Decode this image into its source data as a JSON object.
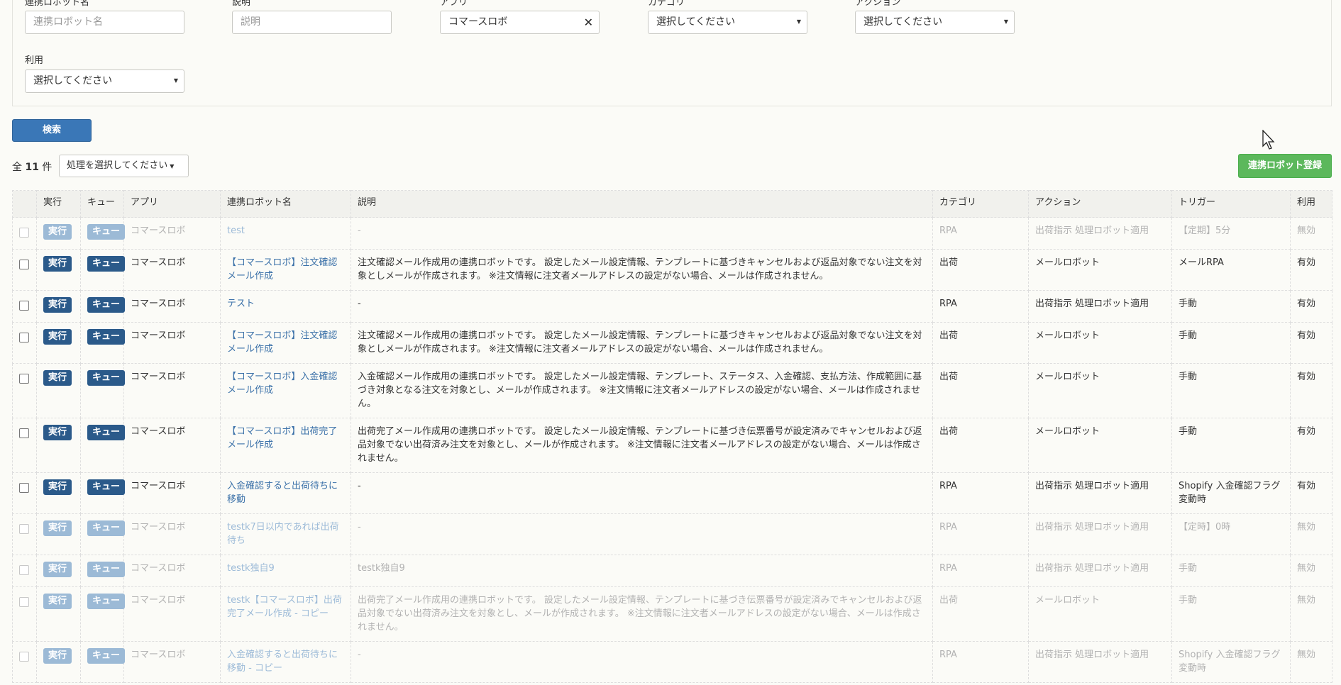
{
  "filters": {
    "robot_name": {
      "label": "連携ロボット名",
      "placeholder": "連携ロボット名"
    },
    "description": {
      "label": "説明",
      "placeholder": "説明"
    },
    "app": {
      "label": "アプリ",
      "value": "コマースロボ"
    },
    "category": {
      "label": "カテゴリ",
      "value": "選択してください"
    },
    "action": {
      "label": "アクション",
      "value": "選択してください"
    },
    "usage": {
      "label": "利用",
      "value": "選択してください"
    }
  },
  "search_button": "検索",
  "total": {
    "prefix": "全",
    "count": "11",
    "suffix": "件"
  },
  "bulk_action": "処理を選択してください",
  "register_button": "連携ロボット登録",
  "table": {
    "headers": [
      "実行",
      "キュー",
      "アプリ",
      "連携ロボット名",
      "説明",
      "カテゴリ",
      "アクション",
      "トリガー",
      "利用"
    ],
    "run_label": "実行",
    "queue_label": "キュー",
    "rows": [
      {
        "app": "コマースロボ",
        "name": "test",
        "desc": "-",
        "category": "RPA",
        "action": "出荷指示 処理ロボット適用",
        "trigger": "【定期】5分",
        "usage": "無効"
      },
      {
        "app": "コマースロボ",
        "name": "【コマースロボ】注文確認メール作成",
        "desc": "注文確認メール作成用の連携ロボットです。 設定したメール設定情報、テンプレートに基づきキャンセルおよび返品対象でない注文を対象としメールが作成されます。 ※注文情報に注文者メールアドレスの設定がない場合、メールは作成されません。",
        "category": "出荷",
        "action": "メールロボット",
        "trigger": "メールRPA",
        "usage": "有効"
      },
      {
        "app": "コマースロボ",
        "name": "テスト",
        "desc": "-",
        "category": "RPA",
        "action": "出荷指示 処理ロボット適用",
        "trigger": "手動",
        "usage": "有効"
      },
      {
        "app": "コマースロボ",
        "name": "【コマースロボ】注文確認メール作成",
        "desc": "注文確認メール作成用の連携ロボットです。 設定したメール設定情報、テンプレートに基づきキャンセルおよび返品対象でない注文を対象としメールが作成されます。 ※注文情報に注文者メールアドレスの設定がない場合、メールは作成されません。",
        "category": "出荷",
        "action": "メールロボット",
        "trigger": "手動",
        "usage": "有効"
      },
      {
        "app": "コマースロボ",
        "name": "【コマースロボ】入金確認メール作成",
        "desc": "入金確認メール作成用の連携ロボットです。 設定したメール設定情報、テンプレート、ステータス、入金確認、支払方法、作成範囲に基づき対象となる注文を対象とし、メールが作成されます。 ※注文情報に注文者メールアドレスの設定がない場合、メールは作成されません。",
        "category": "出荷",
        "action": "メールロボット",
        "trigger": "手動",
        "usage": "有効"
      },
      {
        "app": "コマースロボ",
        "name": "【コマースロボ】出荷完了メール作成",
        "desc": "出荷完了メール作成用の連携ロボットです。 設定したメール設定情報、テンプレートに基づき伝票番号が設定済みでキャンセルおよび返品対象でない出荷済み注文を対象とし、メールが作成されます。 ※注文情報に注文者メールアドレスの設定がない場合、メールは作成されません。",
        "category": "出荷",
        "action": "メールロボット",
        "trigger": "手動",
        "usage": "有効"
      },
      {
        "app": "コマースロボ",
        "name": "入金確認すると出荷待ちに移動",
        "desc": "-",
        "category": "RPA",
        "action": "出荷指示 処理ロボット適用",
        "trigger": "Shopify 入金確認フラグ変動時",
        "usage": "有効"
      },
      {
        "app": "コマースロボ",
        "name": "testk7日以内であれば出荷待ち",
        "desc": "-",
        "category": "RPA",
        "action": "出荷指示 処理ロボット適用",
        "trigger": "【定時】0時",
        "usage": "無効"
      },
      {
        "app": "コマースロボ",
        "name": "testk独自9",
        "desc": "testk独自9",
        "category": "RPA",
        "action": "出荷指示 処理ロボット適用",
        "trigger": "手動",
        "usage": "無効"
      },
      {
        "app": "コマースロボ",
        "name": "testk【コマースロボ】出荷完了メール作成 - コピー",
        "desc": "出荷完了メール作成用の連携ロボットです。 設定したメール設定情報、テンプレートに基づき伝票番号が設定済みでキャンセルおよび返品対象でない出荷済み注文を対象とし、メールが作成されます。 ※注文情報に注文者メールアドレスの設定がない場合、メールは作成されません。",
        "category": "出荷",
        "action": "メールロボット",
        "trigger": "手動",
        "usage": "無効"
      },
      {
        "app": "コマースロボ",
        "name": "入金確認すると出荷待ちに移動 - コピー",
        "desc": "-",
        "category": "RPA",
        "action": "出荷指示 処理ロボット適用",
        "trigger": "Shopify 入金確認フラグ変動時",
        "usage": "無効"
      }
    ]
  }
}
